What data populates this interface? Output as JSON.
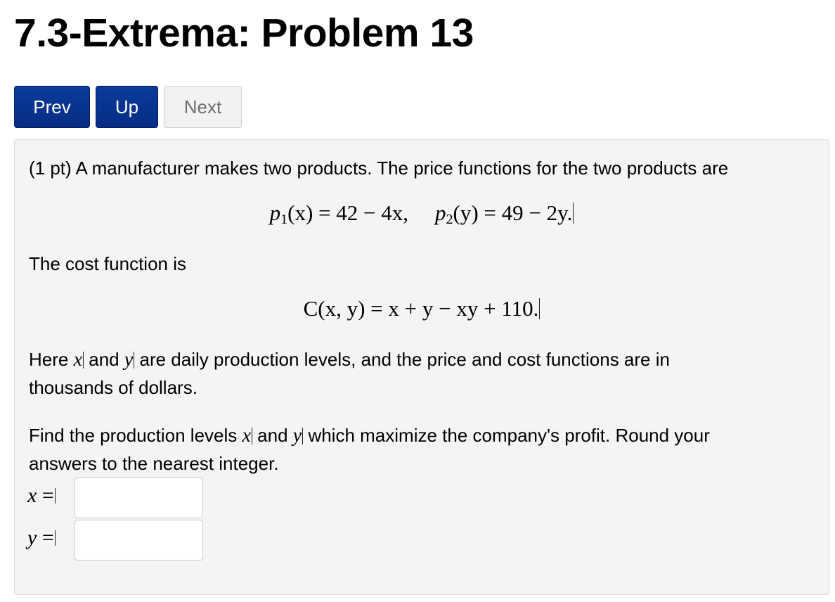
{
  "page_title": "7.3-Extrema: Problem 13",
  "nav": {
    "prev_label": "Prev",
    "up_label": "Up",
    "next_label": "Next"
  },
  "problem": {
    "intro": "(1 pt) A manufacturer makes two products. The price functions for the two products are",
    "price_functions": {
      "p1_name": "p",
      "p1_sub": "1",
      "p1_arg": "(x)",
      "p1_rhs": "= 42 − 4x,",
      "p2_name": "p",
      "p2_sub": "2",
      "p2_arg": "(y)",
      "p2_rhs": "= 49 − 2y."
    },
    "cost_intro": "The cost function is",
    "cost_function": "C(x, y) = x + y − xy + 110.",
    "explanation": {
      "part1": "Here ",
      "var_x": "x",
      "part2": " and ",
      "var_y": "y",
      "part3": " are daily production levels, and the price and cost functions are in",
      "line2": "thousands of dollars."
    },
    "question": {
      "part1": "Find the production levels ",
      "var_x": "x",
      "part2": " and ",
      "var_y": "y",
      "part3": " which maximize the company's profit. Round your",
      "line2": "answers to the nearest integer."
    },
    "answers": [
      {
        "var": "x",
        "eq": "=",
        "value": ""
      },
      {
        "var": "y",
        "eq": "=",
        "value": ""
      }
    ]
  }
}
